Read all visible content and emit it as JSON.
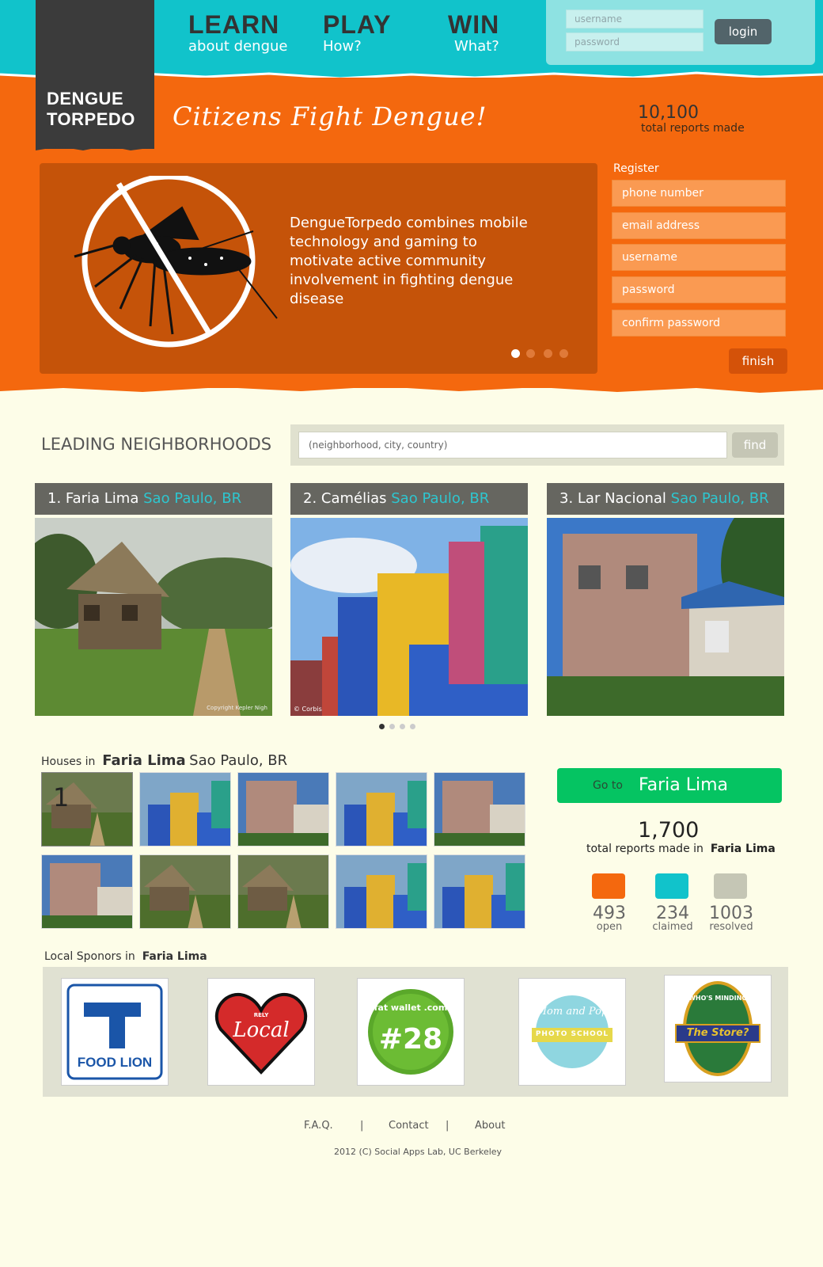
{
  "brand": {
    "line1": "DENGUE",
    "line2": "TORPEDO",
    "tagline": "Citizens Fight Dengue!"
  },
  "nav": [
    {
      "big": "LEARN",
      "small": "about dengue"
    },
    {
      "big": "PLAY",
      "small": "How?"
    },
    {
      "big": "WIN",
      "small": "What?"
    }
  ],
  "login": {
    "username_placeholder": "username",
    "password_placeholder": "password",
    "button": "login"
  },
  "stats": {
    "total": "10,100",
    "label": "total reports made"
  },
  "hero": {
    "text": "DengueTorpedo combines mobile technology and gaming to motivate active community involvement in fighting dengue disease",
    "slides": 4,
    "active_slide": 1
  },
  "register": {
    "label": "Register",
    "fields": [
      "phone number",
      "email address",
      "username",
      "password",
      "confirm password"
    ],
    "button": "finish"
  },
  "neighborhoods": {
    "title": "LEADING NEIGHBORHOODS",
    "search_placeholder": "(neighborhood, city, country)",
    "find": "find",
    "items": [
      {
        "rank": "1. Faria Lima",
        "city": "Sao Paulo, BR",
        "credit": "Copyright Kepler Nigh"
      },
      {
        "rank": "2. Camélias",
        "city": "Sao Paulo, BR",
        "credit": "© Corbis"
      },
      {
        "rank": "3. Lar Nacional",
        "city": "Sao Paulo, BR",
        "credit": ""
      }
    ]
  },
  "houses": {
    "prefix": "Houses in",
    "name": "Faria Lima",
    "city": "Sao Paulo, BR",
    "first_badge": "1"
  },
  "goto": {
    "prefix": "Go to",
    "name": "Faria Lima"
  },
  "reports": {
    "total": "1,700",
    "label": "total reports made in",
    "name": "Faria Lima",
    "open": {
      "count": "493",
      "label": "open",
      "color": "#f4680e"
    },
    "claimed": {
      "count": "234",
      "label": "claimed",
      "color": "#11c3cb"
    },
    "resolved": {
      "count": "1003",
      "label": "resolved",
      "color": "#c5c6b5"
    }
  },
  "sponsors": {
    "prefix": "Local Sponors in",
    "name": "Faria Lima",
    "logos": [
      {
        "text": "FOOD LION"
      },
      {
        "top": "RELY",
        "text": "Local"
      },
      {
        "top": "fat wallet .com",
        "text": "#28"
      },
      {
        "top": "Mom and Pop",
        "text": "PHOTO SCHOOL"
      },
      {
        "top": "WHO'S MINDING",
        "text": "The Store?"
      }
    ]
  },
  "footer": {
    "faq": "F.A.Q.",
    "contact": "Contact",
    "about": "About",
    "sep": "|",
    "copyright": "2012 (C) Social Apps Lab, UC Berkeley"
  }
}
